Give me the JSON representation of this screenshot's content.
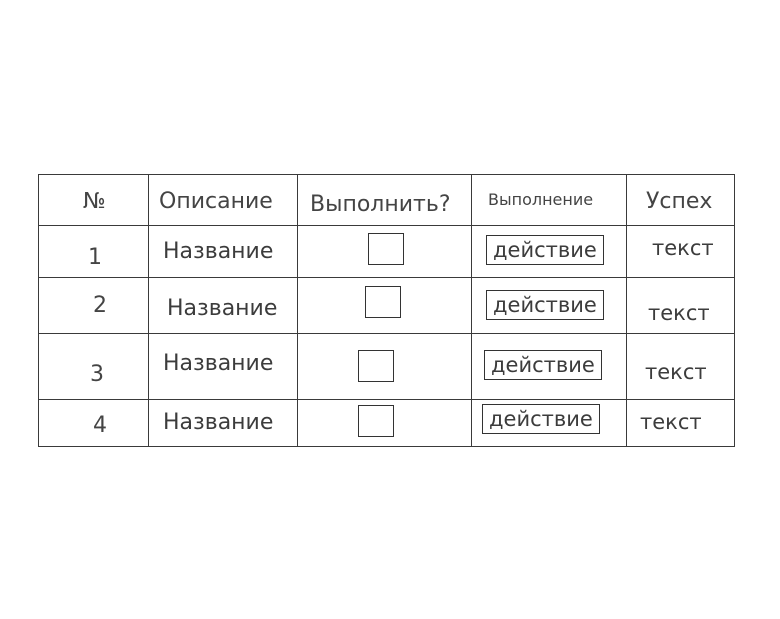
{
  "table": {
    "headers": {
      "number": "№",
      "description": "Описание",
      "execute": "Выполнить?",
      "execution": "Выполнение",
      "success": "Успех"
    },
    "rows": [
      {
        "number": "1",
        "name": "Название",
        "action_label": "действие",
        "result": "текст",
        "checked": false
      },
      {
        "number": "2",
        "name": "Название",
        "action_label": "действие",
        "result": "текст",
        "checked": false
      },
      {
        "number": "3",
        "name": "Название",
        "action_label": "действие",
        "result": "текст",
        "checked": false
      },
      {
        "number": "4",
        "name": "Название",
        "action_label": "действие",
        "result": "текст",
        "checked": false
      }
    ]
  }
}
